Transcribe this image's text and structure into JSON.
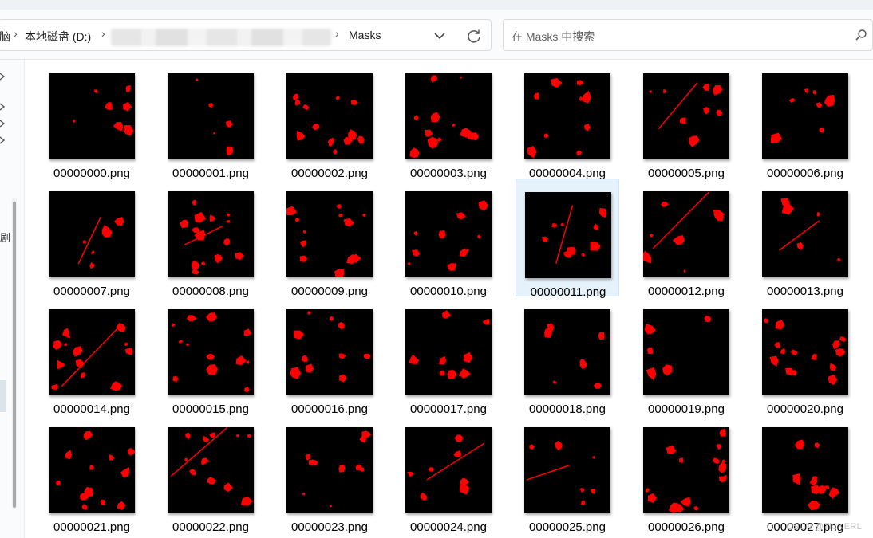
{
  "breadcrumb": {
    "partial_left": "脑",
    "drive": "本地磁盘 (D:)",
    "folder": "Masks"
  },
  "search": {
    "placeholder": "在 Masks 中搜索"
  },
  "nav": {
    "partial_label": "剧"
  },
  "files": [
    {
      "name": "00000000.png"
    },
    {
      "name": "00000001.png"
    },
    {
      "name": "00000002.png"
    },
    {
      "name": "00000003.png"
    },
    {
      "name": "00000004.png"
    },
    {
      "name": "00000005.png"
    },
    {
      "name": "00000006.png"
    },
    {
      "name": "00000007.png"
    },
    {
      "name": "00000008.png"
    },
    {
      "name": "00000009.png"
    },
    {
      "name": "00000010.png"
    },
    {
      "name": "00000011.png",
      "selected": true
    },
    {
      "name": "00000012.png"
    },
    {
      "name": "00000013.png"
    },
    {
      "name": "00000014.png"
    },
    {
      "name": "00000015.png"
    },
    {
      "name": "00000016.png"
    },
    {
      "name": "00000017.png"
    },
    {
      "name": "00000018.png"
    },
    {
      "name": "00000019.png"
    },
    {
      "name": "00000020.png"
    },
    {
      "name": "00000021.png"
    },
    {
      "name": "00000022.png"
    },
    {
      "name": "00000023.png"
    },
    {
      "name": "00000024.png"
    },
    {
      "name": "00000025.png"
    },
    {
      "name": "00000026.png"
    },
    {
      "name": "00000027.png"
    }
  ],
  "watermark": "CSDN @TiCKERL",
  "colors": {
    "mask_background": "#000000",
    "mask_foreground": "#ff0000",
    "selection": "#e5f1fb"
  }
}
